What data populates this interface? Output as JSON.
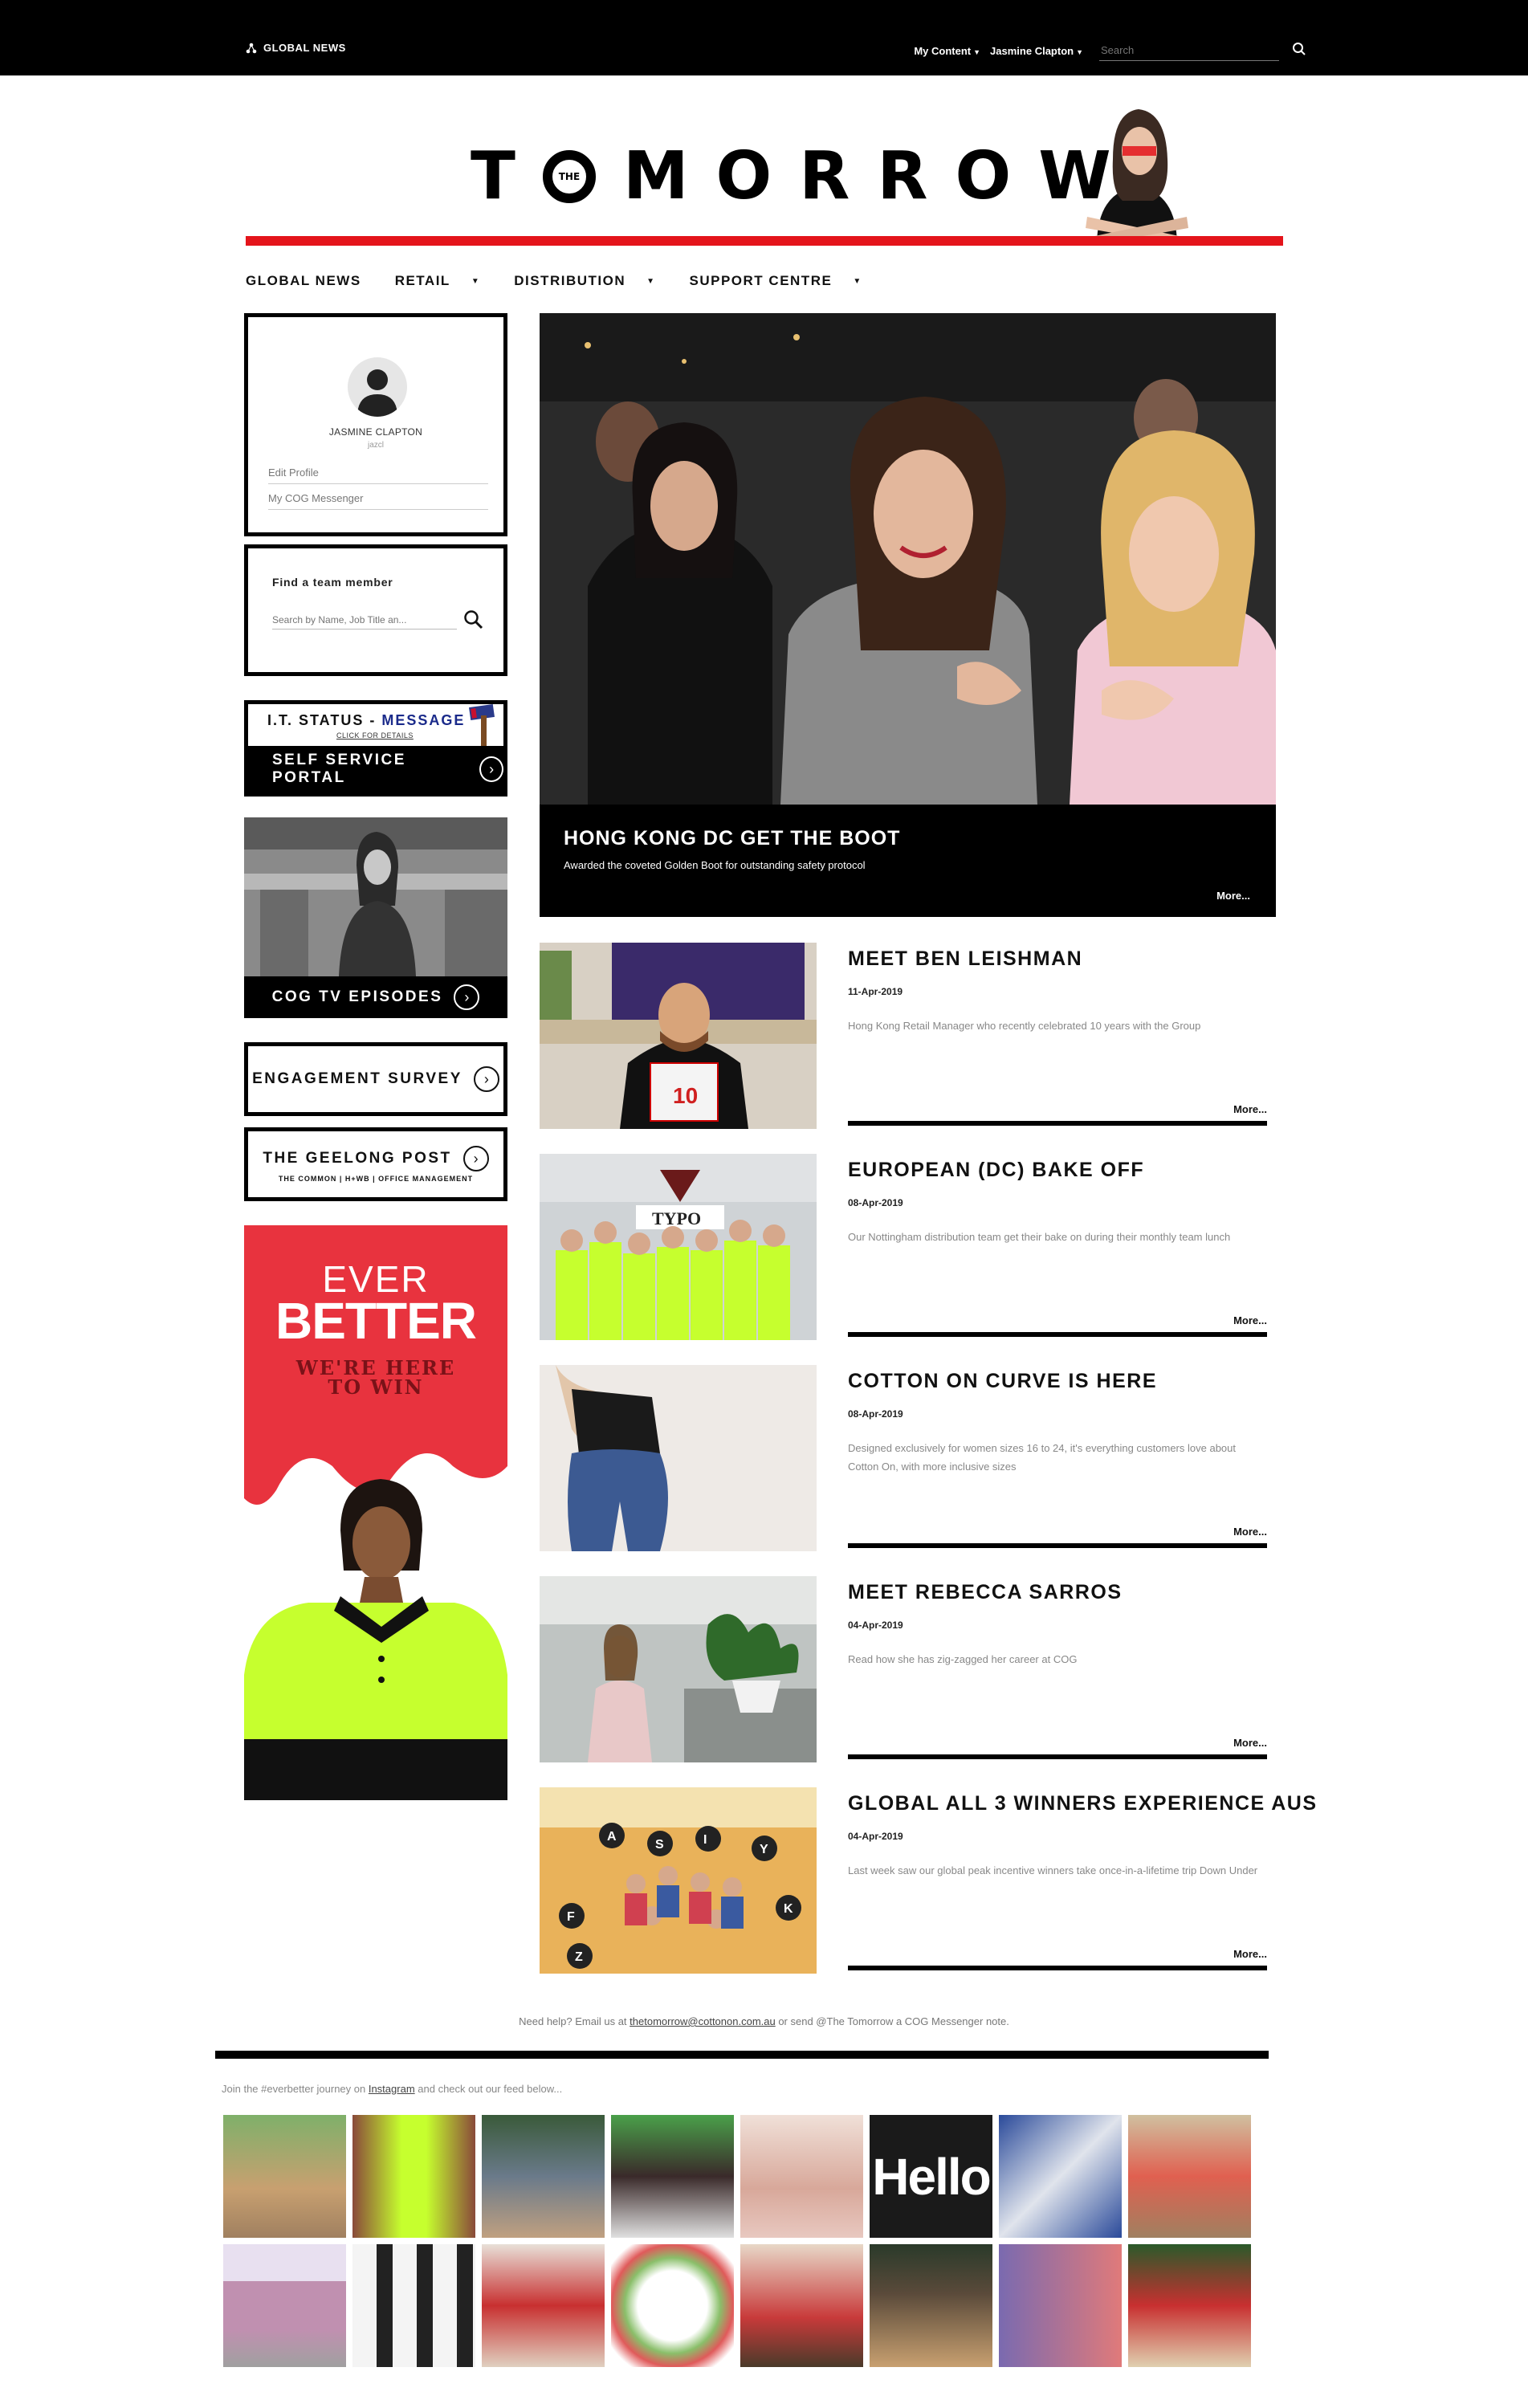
{
  "topbar": {
    "brand": "GLOBAL NEWS",
    "my_content": "My Content",
    "user_name": "Jasmine Clapton",
    "search_placeholder": "Search"
  },
  "masthead": {
    "logo_the": "THE",
    "logo_text": "TOMORROW."
  },
  "nav": {
    "items": [
      {
        "label": "GLOBAL NEWS",
        "has_dropdown": false
      },
      {
        "label": "RETAIL",
        "has_dropdown": true
      },
      {
        "label": "DISTRIBUTION",
        "has_dropdown": true
      },
      {
        "label": "SUPPORT CENTRE",
        "has_dropdown": true
      }
    ]
  },
  "profile": {
    "name": "JASMINE CLAPTON",
    "username": "jazcl",
    "links": [
      "Edit Profile",
      "My COG Messenger"
    ]
  },
  "finder": {
    "title": "Find a team member",
    "placeholder": "Search by Name, Job Title an..."
  },
  "it_status": {
    "title_a": "I.T. STATUS - ",
    "title_b": "MESSAGE",
    "subtitle": "CLICK FOR DETAILS",
    "portal_label": "SELF SERVICE PORTAL"
  },
  "cog_tv": {
    "label": "COG TV EPISODES"
  },
  "engagement": {
    "label": "ENGAGEMENT SURVEY"
  },
  "geelong": {
    "label": "THE GEELONG POST",
    "sub": "THE COMMON  |  H+WB  |  OFFICE MANAGEMENT"
  },
  "ad": {
    "ever": "EVER",
    "better": "BETTER",
    "tag_line1": "WE'RE HERE",
    "tag_line2": "TO WIN"
  },
  "hero": {
    "title": "HONG KONG DC GET THE BOOT",
    "subtitle": "Awarded the coveted Golden Boot for outstanding safety protocol",
    "more": "More..."
  },
  "articles": [
    {
      "title": "MEET BEN LEISHMAN",
      "date": "11-Apr-2019",
      "text": "Hong Kong Retail Manager who recently celebrated 10 years with the Group",
      "more": "More..."
    },
    {
      "title": "EUROPEAN (DC) BAKE OFF",
      "date": "08-Apr-2019",
      "text": "Our Nottingham distribution team get their bake on during their monthly team lunch",
      "more": "More..."
    },
    {
      "title": "COTTON ON CURVE IS HERE",
      "date": "08-Apr-2019",
      "text": "Designed exclusively for women sizes 16 to 24, it's everything customers love about Cotton On, with more inclusive sizes",
      "more": "More..."
    },
    {
      "title": "MEET REBECCA SARROS",
      "date": "04-Apr-2019",
      "text": "Read how she has zig-zagged her career at COG",
      "more": "More..."
    },
    {
      "title": "GLOBAL ALL 3 WINNERS EXPERIENCE AUS",
      "date": "04-Apr-2019",
      "text": "Last week saw our global peak incentive winners take once-in-a-lifetime trip Down Under",
      "more": "More..."
    }
  ],
  "footer": {
    "help_prefix": "Need help?  Email us at ",
    "help_email": "thetomorrow@cottonon.com.au",
    "help_suffix": " or send @The Tomorrow a COG Messenger note.",
    "join_prefix": "Join the #everbetter journey on ",
    "join_link": "Instagram",
    "join_suffix": " and check out our feed below..."
  },
  "instagram": {
    "hello_text": "Hello"
  },
  "colors": {
    "accent_red": "#e4141b",
    "it_blue": "#1a2a8a",
    "ad_red": "#e8333e",
    "hivis_yellow": "#c6ff2e"
  }
}
